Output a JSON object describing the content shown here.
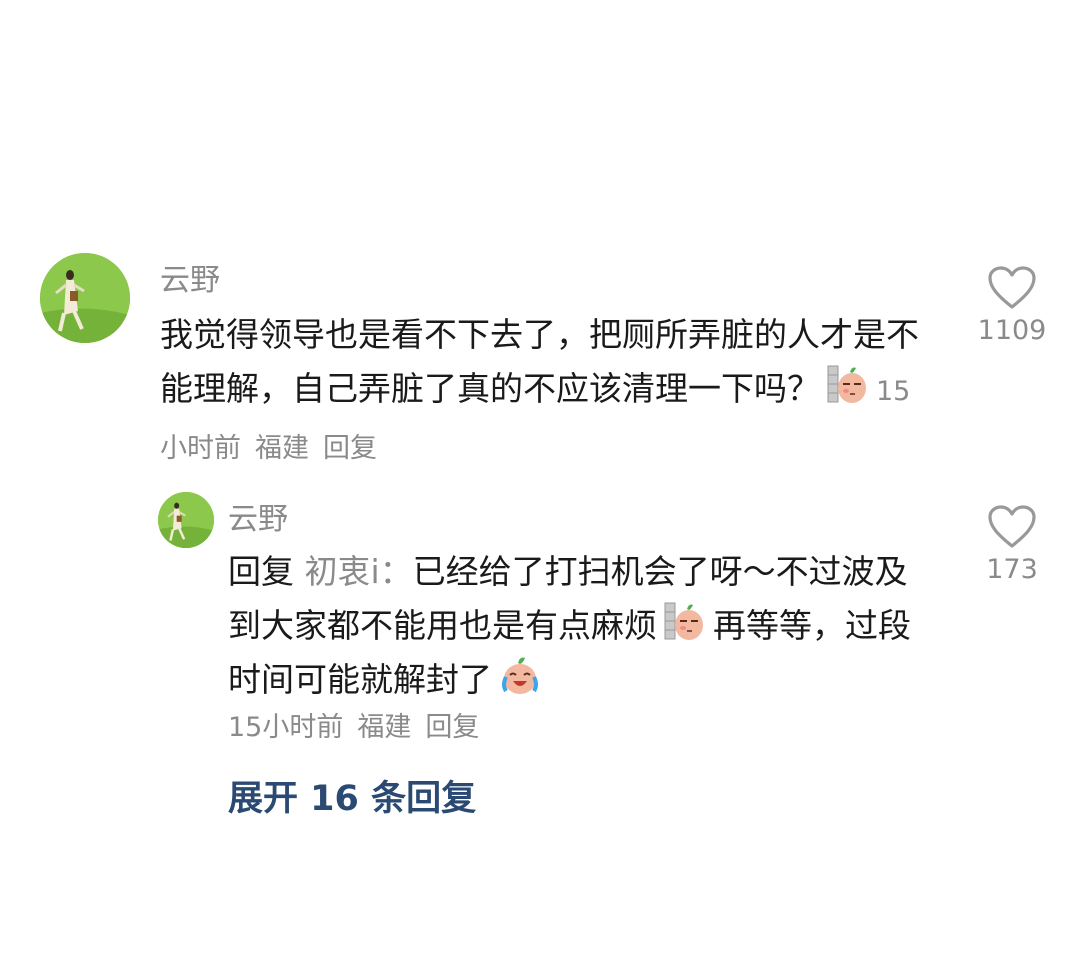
{
  "comment": {
    "author": "云野",
    "avatar_icon": "runner-on-grass-avatar",
    "text": "我觉得领导也是看不下去了，把厕所弄脏的人才是不能理解，自己弄脏了真的不应该清理一下吗？",
    "emoji": "peeking-sweet-potato-emoji",
    "time": "15小时前",
    "location": "福建",
    "reply_label": "回复",
    "likes": "1109"
  },
  "reply": {
    "author": "云野",
    "avatar_icon": "runner-on-grass-avatar",
    "prefix": "回复",
    "mention": "初衷i：",
    "text_part1": "已经给了打扫机会了呀～不过波及到大家都不能用也是有点麻烦",
    "emoji1": "peeking-sweet-potato-emoji",
    "text_part2": "再等等，过段时间可能就解封了",
    "emoji2": "crying-laughing-sweet-potato-emoji",
    "time": "15小时前",
    "location": "福建",
    "reply_label": "回复",
    "likes": "173"
  },
  "expand_label": "展开 16 条回复",
  "colors": {
    "text": "#1a1a1a",
    "muted": "#8a8a8a",
    "link": "#2b4a73"
  }
}
